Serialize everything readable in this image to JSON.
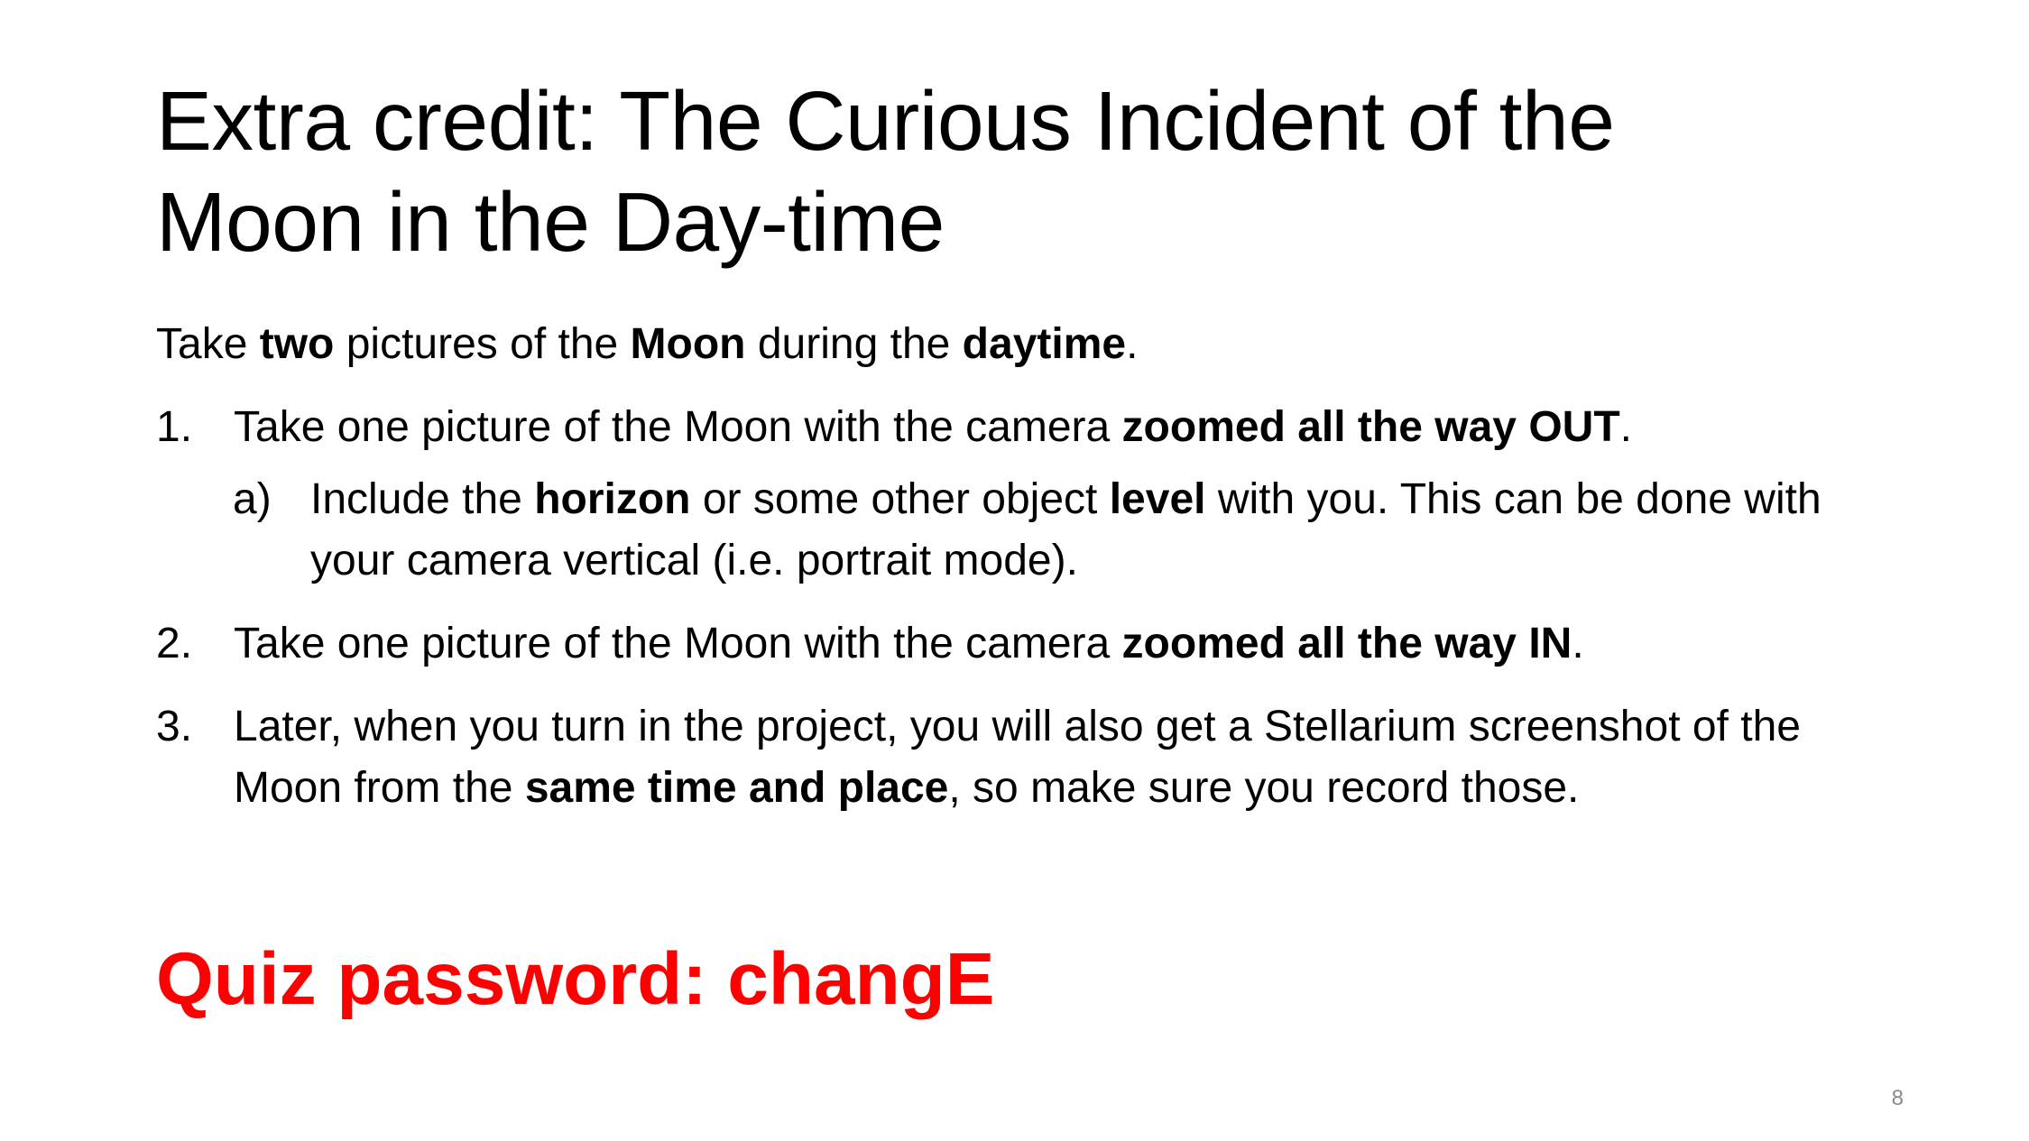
{
  "slide": {
    "title_line1": "Extra credit: The Curious Incident of the",
    "title_line2": "Moon in the Day-time",
    "intro": {
      "t1": "Take ",
      "b1": "two",
      "t2": " pictures of the ",
      "b2": "Moon",
      "t3": " during the ",
      "b3": "daytime",
      "t4": "."
    },
    "items": [
      {
        "num": "1.",
        "t1": "Take one picture of the Moon with the camera ",
        "b1": "zoomed all the way OUT",
        "t2": "."
      },
      {
        "num": "2.",
        "t1": "Take one picture of the Moon with the camera ",
        "b1": "zoomed all the way IN",
        "t2": "."
      },
      {
        "num": "3.",
        "t1": "Later, when you turn in the project, you will also get a Stellarium screenshot of the Moon from the ",
        "b1": "same time and place",
        "t2": ", so make sure you record those."
      }
    ],
    "subitem": {
      "num": "a)",
      "t1": "Include the ",
      "b1": "horizon",
      "t2": " or some other object ",
      "b2": "level",
      "t3": " with you. This can be done with your camera vertical (i.e. portrait mode)."
    },
    "password": "Quiz password: changE",
    "page_number": "8"
  },
  "colors": {
    "text": "#000000",
    "password": "#ff0000",
    "page_number": "#8a8a8a",
    "background": "#ffffff"
  }
}
